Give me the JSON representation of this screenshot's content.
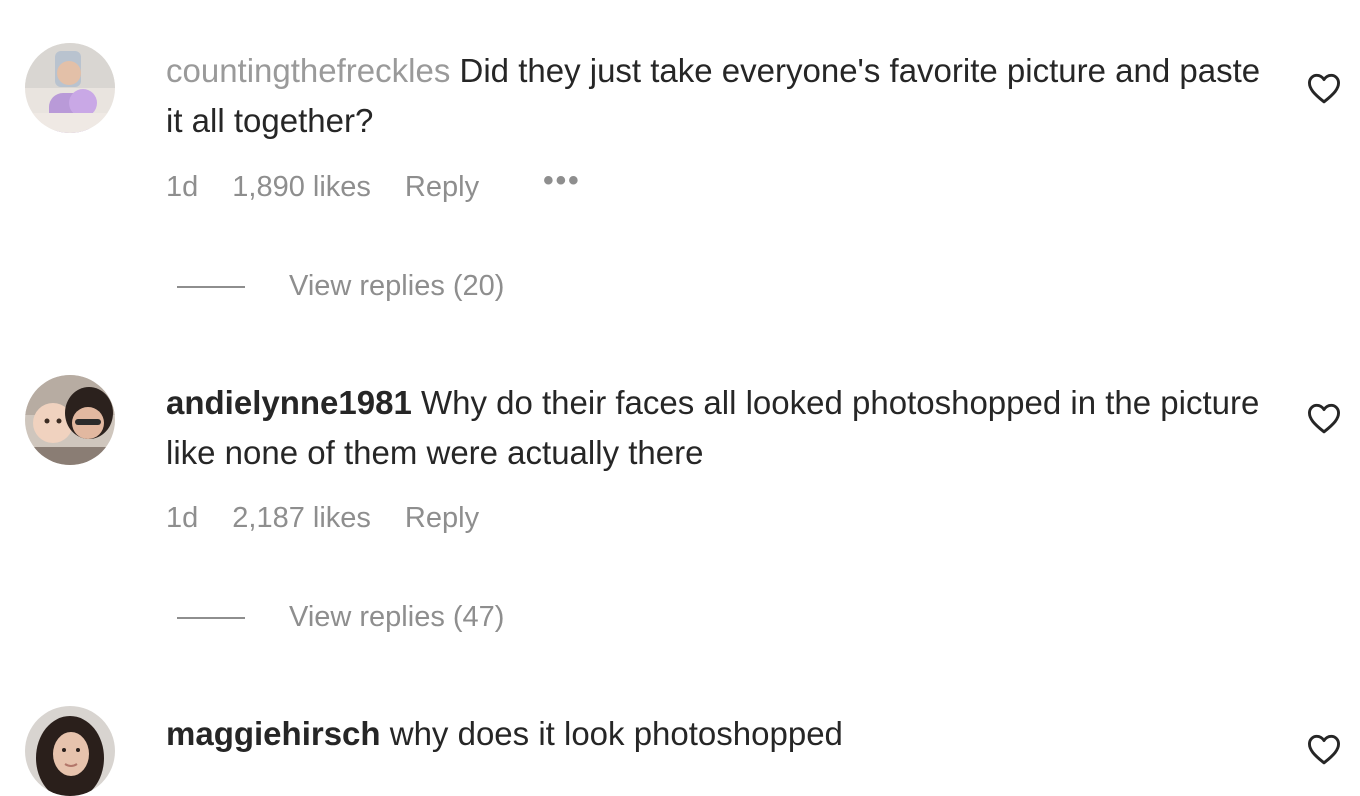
{
  "comments": [
    {
      "username": "countingthefreckles",
      "text": "Did they just take everyone's favorite picture and paste it all together?",
      "time": "1d",
      "likes": "1,890 likes",
      "reply_label": "Reply",
      "more_label": "•••",
      "view_replies": "View replies (20)"
    },
    {
      "username": "andielynne1981",
      "text": "Why do their faces all looked photoshopped in the picture like none of them were actually there",
      "time": "1d",
      "likes": "2,187 likes",
      "reply_label": "Reply",
      "view_replies": "View replies (47)"
    },
    {
      "username": "maggiehirsch",
      "text": "why does it look photoshopped"
    }
  ],
  "icons": {
    "like": "heart-outline-icon"
  },
  "colors": {
    "text": "#262626",
    "secondary": "#8e8e8e",
    "faded_username": "#9a9a9a"
  }
}
